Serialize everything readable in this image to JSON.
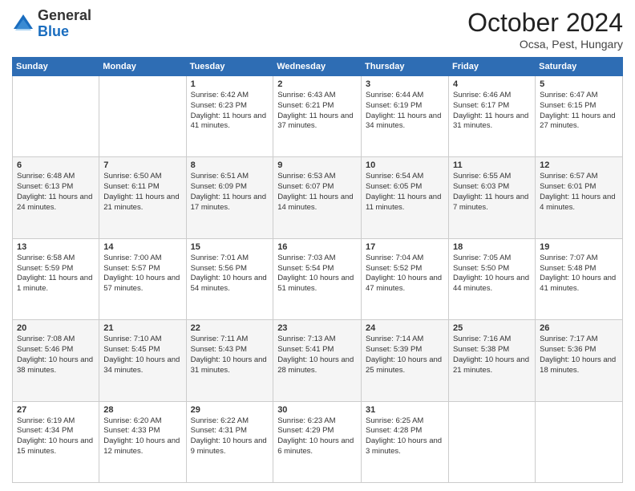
{
  "header": {
    "logo_general": "General",
    "logo_blue": "Blue",
    "month_title": "October 2024",
    "location": "Ocsa, Pest, Hungary"
  },
  "days_of_week": [
    "Sunday",
    "Monday",
    "Tuesday",
    "Wednesday",
    "Thursday",
    "Friday",
    "Saturday"
  ],
  "weeks": [
    [
      {
        "day": "",
        "sunrise": "",
        "sunset": "",
        "daylight": ""
      },
      {
        "day": "",
        "sunrise": "",
        "sunset": "",
        "daylight": ""
      },
      {
        "day": "1",
        "sunrise": "Sunrise: 6:42 AM",
        "sunset": "Sunset: 6:23 PM",
        "daylight": "Daylight: 11 hours and 41 minutes."
      },
      {
        "day": "2",
        "sunrise": "Sunrise: 6:43 AM",
        "sunset": "Sunset: 6:21 PM",
        "daylight": "Daylight: 11 hours and 37 minutes."
      },
      {
        "day": "3",
        "sunrise": "Sunrise: 6:44 AM",
        "sunset": "Sunset: 6:19 PM",
        "daylight": "Daylight: 11 hours and 34 minutes."
      },
      {
        "day": "4",
        "sunrise": "Sunrise: 6:46 AM",
        "sunset": "Sunset: 6:17 PM",
        "daylight": "Daylight: 11 hours and 31 minutes."
      },
      {
        "day": "5",
        "sunrise": "Sunrise: 6:47 AM",
        "sunset": "Sunset: 6:15 PM",
        "daylight": "Daylight: 11 hours and 27 minutes."
      }
    ],
    [
      {
        "day": "6",
        "sunrise": "Sunrise: 6:48 AM",
        "sunset": "Sunset: 6:13 PM",
        "daylight": "Daylight: 11 hours and 24 minutes."
      },
      {
        "day": "7",
        "sunrise": "Sunrise: 6:50 AM",
        "sunset": "Sunset: 6:11 PM",
        "daylight": "Daylight: 11 hours and 21 minutes."
      },
      {
        "day": "8",
        "sunrise": "Sunrise: 6:51 AM",
        "sunset": "Sunset: 6:09 PM",
        "daylight": "Daylight: 11 hours and 17 minutes."
      },
      {
        "day": "9",
        "sunrise": "Sunrise: 6:53 AM",
        "sunset": "Sunset: 6:07 PM",
        "daylight": "Daylight: 11 hours and 14 minutes."
      },
      {
        "day": "10",
        "sunrise": "Sunrise: 6:54 AM",
        "sunset": "Sunset: 6:05 PM",
        "daylight": "Daylight: 11 hours and 11 minutes."
      },
      {
        "day": "11",
        "sunrise": "Sunrise: 6:55 AM",
        "sunset": "Sunset: 6:03 PM",
        "daylight": "Daylight: 11 hours and 7 minutes."
      },
      {
        "day": "12",
        "sunrise": "Sunrise: 6:57 AM",
        "sunset": "Sunset: 6:01 PM",
        "daylight": "Daylight: 11 hours and 4 minutes."
      }
    ],
    [
      {
        "day": "13",
        "sunrise": "Sunrise: 6:58 AM",
        "sunset": "Sunset: 5:59 PM",
        "daylight": "Daylight: 11 hours and 1 minute."
      },
      {
        "day": "14",
        "sunrise": "Sunrise: 7:00 AM",
        "sunset": "Sunset: 5:57 PM",
        "daylight": "Daylight: 10 hours and 57 minutes."
      },
      {
        "day": "15",
        "sunrise": "Sunrise: 7:01 AM",
        "sunset": "Sunset: 5:56 PM",
        "daylight": "Daylight: 10 hours and 54 minutes."
      },
      {
        "day": "16",
        "sunrise": "Sunrise: 7:03 AM",
        "sunset": "Sunset: 5:54 PM",
        "daylight": "Daylight: 10 hours and 51 minutes."
      },
      {
        "day": "17",
        "sunrise": "Sunrise: 7:04 AM",
        "sunset": "Sunset: 5:52 PM",
        "daylight": "Daylight: 10 hours and 47 minutes."
      },
      {
        "day": "18",
        "sunrise": "Sunrise: 7:05 AM",
        "sunset": "Sunset: 5:50 PM",
        "daylight": "Daylight: 10 hours and 44 minutes."
      },
      {
        "day": "19",
        "sunrise": "Sunrise: 7:07 AM",
        "sunset": "Sunset: 5:48 PM",
        "daylight": "Daylight: 10 hours and 41 minutes."
      }
    ],
    [
      {
        "day": "20",
        "sunrise": "Sunrise: 7:08 AM",
        "sunset": "Sunset: 5:46 PM",
        "daylight": "Daylight: 10 hours and 38 minutes."
      },
      {
        "day": "21",
        "sunrise": "Sunrise: 7:10 AM",
        "sunset": "Sunset: 5:45 PM",
        "daylight": "Daylight: 10 hours and 34 minutes."
      },
      {
        "day": "22",
        "sunrise": "Sunrise: 7:11 AM",
        "sunset": "Sunset: 5:43 PM",
        "daylight": "Daylight: 10 hours and 31 minutes."
      },
      {
        "day": "23",
        "sunrise": "Sunrise: 7:13 AM",
        "sunset": "Sunset: 5:41 PM",
        "daylight": "Daylight: 10 hours and 28 minutes."
      },
      {
        "day": "24",
        "sunrise": "Sunrise: 7:14 AM",
        "sunset": "Sunset: 5:39 PM",
        "daylight": "Daylight: 10 hours and 25 minutes."
      },
      {
        "day": "25",
        "sunrise": "Sunrise: 7:16 AM",
        "sunset": "Sunset: 5:38 PM",
        "daylight": "Daylight: 10 hours and 21 minutes."
      },
      {
        "day": "26",
        "sunrise": "Sunrise: 7:17 AM",
        "sunset": "Sunset: 5:36 PM",
        "daylight": "Daylight: 10 hours and 18 minutes."
      }
    ],
    [
      {
        "day": "27",
        "sunrise": "Sunrise: 6:19 AM",
        "sunset": "Sunset: 4:34 PM",
        "daylight": "Daylight: 10 hours and 15 minutes."
      },
      {
        "day": "28",
        "sunrise": "Sunrise: 6:20 AM",
        "sunset": "Sunset: 4:33 PM",
        "daylight": "Daylight: 10 hours and 12 minutes."
      },
      {
        "day": "29",
        "sunrise": "Sunrise: 6:22 AM",
        "sunset": "Sunset: 4:31 PM",
        "daylight": "Daylight: 10 hours and 9 minutes."
      },
      {
        "day": "30",
        "sunrise": "Sunrise: 6:23 AM",
        "sunset": "Sunset: 4:29 PM",
        "daylight": "Daylight: 10 hours and 6 minutes."
      },
      {
        "day": "31",
        "sunrise": "Sunrise: 6:25 AM",
        "sunset": "Sunset: 4:28 PM",
        "daylight": "Daylight: 10 hours and 3 minutes."
      },
      {
        "day": "",
        "sunrise": "",
        "sunset": "",
        "daylight": ""
      },
      {
        "day": "",
        "sunrise": "",
        "sunset": "",
        "daylight": ""
      }
    ]
  ]
}
